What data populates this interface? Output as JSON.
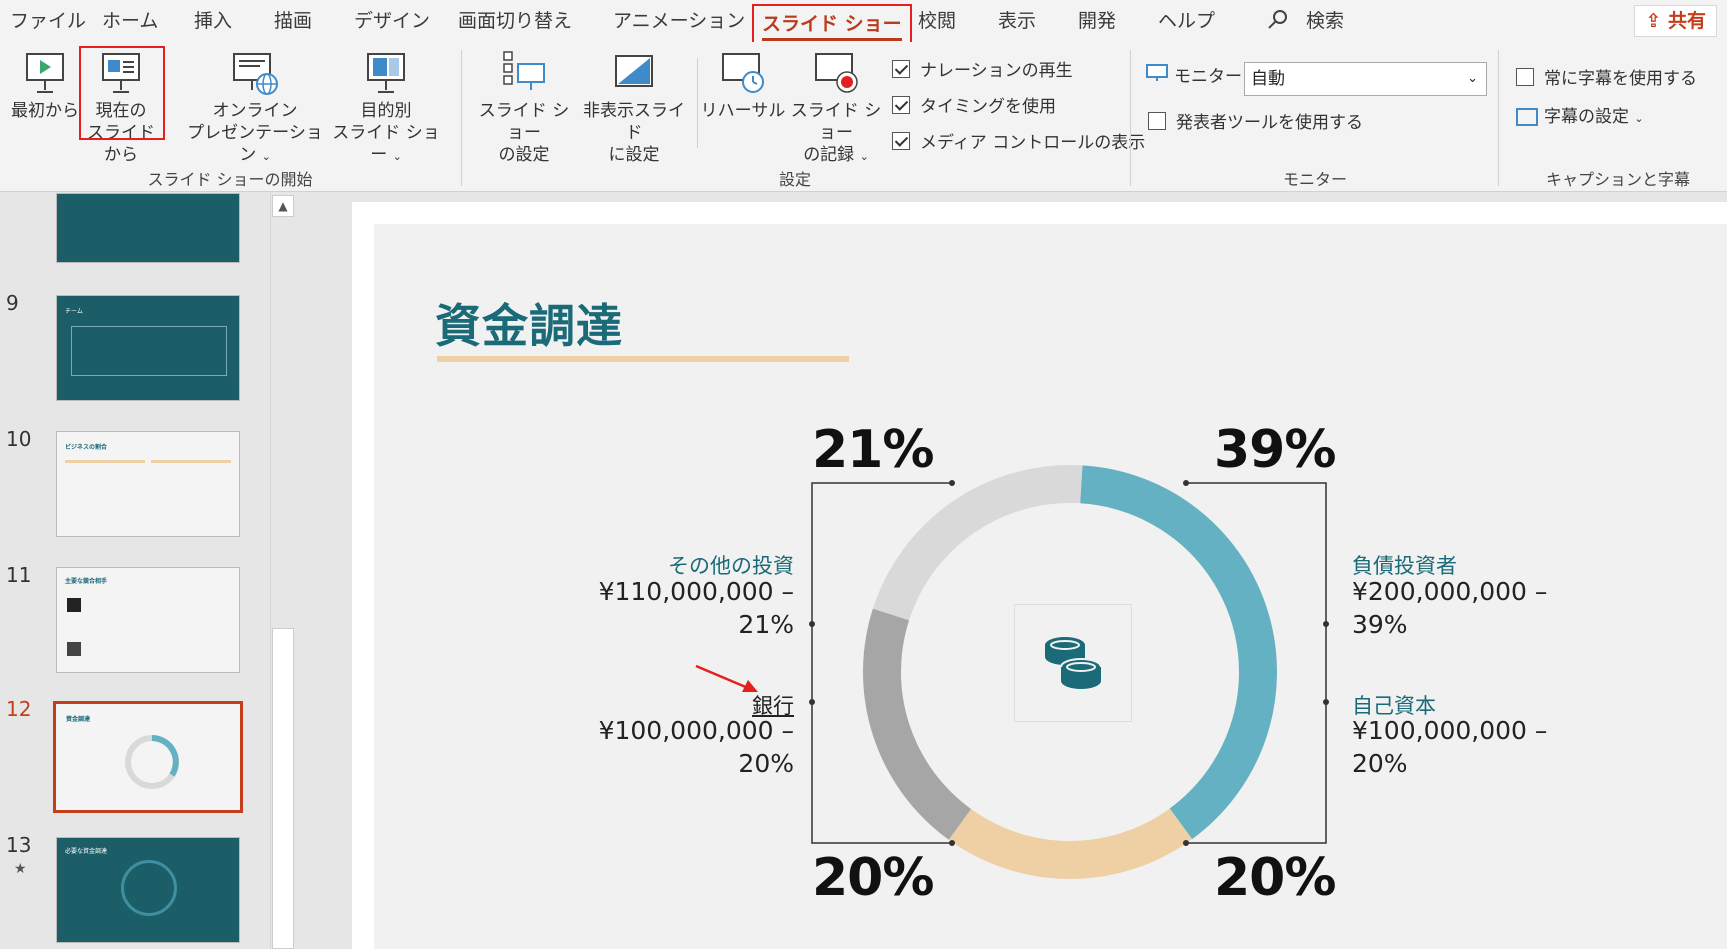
{
  "tabs": [
    "ファイル",
    "ホーム",
    "挿入",
    "描画",
    "デザイン",
    "画面切り替え",
    "アニメーション",
    "スライド ショー",
    "校閲",
    "表示",
    "開発",
    "ヘルプ"
  ],
  "active_tab": "スライド ショー",
  "search_label": "検索",
  "share_label": "共有",
  "ribbon": {
    "start_group": {
      "from_beginning": "最初から",
      "from_current_1": "現在の",
      "from_current_2": "スライドから",
      "online_1": "オンライン",
      "online_2": "プレゼンテーション",
      "custom_1": "目的別",
      "custom_2": "スライド ショー",
      "label": "スライド ショーの開始"
    },
    "setup_group": {
      "setup_1": "スライド ショー",
      "setup_2": "の設定",
      "hide_1": "非表示スライド",
      "hide_2": "に設定",
      "rehearse": "リハーサル",
      "record_1": "スライド ショー",
      "record_2": "の記録",
      "play_narration": "ナレーションの再生",
      "use_timings": "タイミングを使用",
      "media_controls": "メディア コントロールの表示",
      "label": "設定"
    },
    "monitor_group": {
      "monitor_label": "モニター:",
      "monitor_value": "自動",
      "presenter_view": "発表者ツールを使用する",
      "label": "モニター"
    },
    "caption_group": {
      "always_subtitles": "常に字幕を使用する",
      "subtitle_settings": "字幕の設定",
      "label": "キャプションと字幕"
    }
  },
  "thumbnails": [
    {
      "num": "9",
      "title": "チーム"
    },
    {
      "num": "10",
      "title": "ビジネスの割合"
    },
    {
      "num": "11",
      "title": "主要な競合相手"
    },
    {
      "num": "12",
      "title": "資金調達"
    },
    {
      "num": "13",
      "title": "必要な資金調達"
    }
  ],
  "slide": {
    "title": "資金調達",
    "pct_top_left": "21%",
    "pct_top_right": "39%",
    "pct_bottom_left": "20%",
    "pct_bottom_right": "20%",
    "other_name": "その他の投資",
    "other_val_1": "¥110,000,000 –",
    "other_val_2": "21%",
    "bank_name": "銀行",
    "bank_val_1": "¥100,000,000 –",
    "bank_val_2": "20%",
    "debt_name": "負債投資者",
    "debt_val_1": "¥200,000,000 –",
    "debt_val_2": "39%",
    "equity_name": "自己資本",
    "equity_val_1": "¥100,000,000 –",
    "equity_val_2": "20%"
  },
  "donut": {
    "segments": [
      {
        "label": "負債投資者",
        "value": 39,
        "color": "#64b1c3"
      },
      {
        "label": "自己資本",
        "value": 20,
        "color": "#efcfa4"
      },
      {
        "label": "銀行",
        "value": 20,
        "color": "#a6a6a6"
      },
      {
        "label": "その他の投資",
        "value": 21,
        "color": "#d9d9d9"
      }
    ]
  }
}
